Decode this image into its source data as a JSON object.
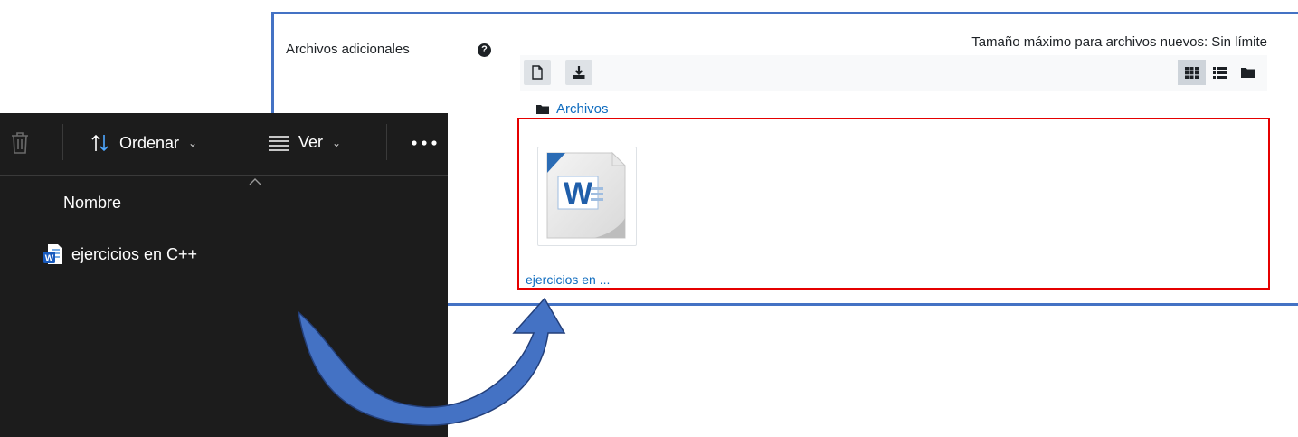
{
  "moodle": {
    "field_label": "Archivos adicionales",
    "help_icon": "question-circle-icon",
    "max_size_text": "Tamaño máximo para archivos nuevos: Sin límite",
    "toolbar": {
      "add_icon": "file-add-icon",
      "download_icon": "download-icon",
      "views": [
        {
          "icon": "grid-view-icon",
          "active": true
        },
        {
          "icon": "list-view-icon",
          "active": false
        },
        {
          "icon": "tree-view-icon",
          "active": false
        }
      ]
    },
    "breadcrumb": {
      "icon": "folder-icon",
      "label": "Archivos"
    },
    "files": [
      {
        "icon": "word-document-icon",
        "name": "ejercicios en ..."
      }
    ],
    "highlight_color": "#e50000",
    "frame_color": "#4472c4"
  },
  "explorer": {
    "toolbar": {
      "delete_icon": "trash-icon",
      "sort_label": "Ordenar",
      "view_label": "Ver",
      "more_icon": "more-icon"
    },
    "column_header": "Nombre",
    "files": [
      {
        "icon": "word-document-icon",
        "name": "ejercicios en C++"
      }
    ]
  },
  "arrow": {
    "icon": "curved-arrow-icon",
    "color": "#4472c4"
  }
}
